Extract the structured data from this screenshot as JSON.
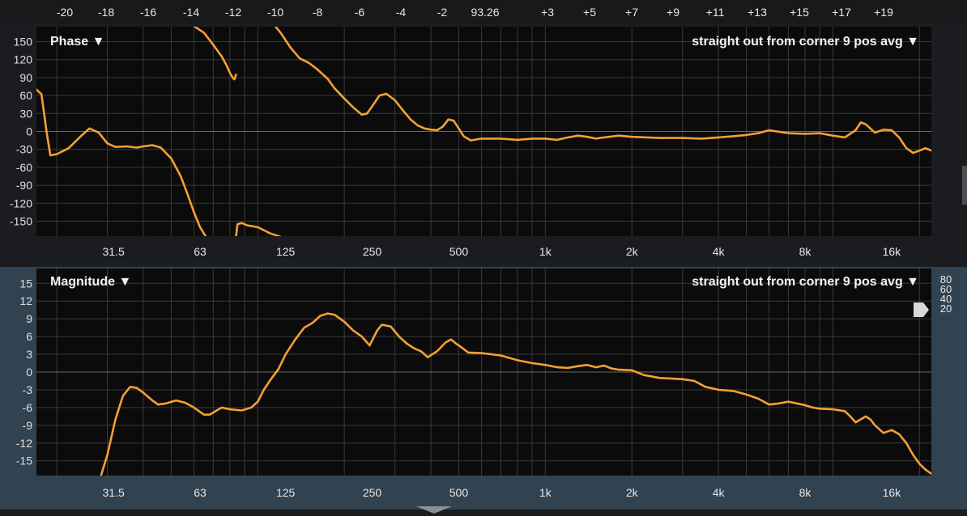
{
  "header": {
    "ticks": [
      "-20",
      "-18",
      "-16",
      "-14",
      "-12",
      "-10",
      "-8",
      "-6",
      "-4",
      "-2",
      "93.26",
      "+3",
      "+5",
      "+7",
      "+9",
      "+11",
      "+13",
      "+15",
      "+17",
      "+19"
    ]
  },
  "colors": {
    "curve": "#f5a033",
    "grid": "#3a3a3a",
    "plot_bg": "#0b0b0b"
  },
  "phase": {
    "title": "Phase ▼",
    "measurement": "straight out from corner 9 pos avg ▼"
  },
  "magnitude": {
    "title": "Magnitude ▼",
    "measurement": "straight out from corner 9 pos avg ▼",
    "right_scale": [
      "80",
      "60",
      "40",
      "20"
    ]
  },
  "chart_data": [
    {
      "type": "line",
      "name": "Phase",
      "x_scale": "log",
      "xlim": [
        17,
        22000
      ],
      "ylim": [
        -175,
        175
      ],
      "x_ticks": [
        31.5,
        63,
        125,
        250,
        500,
        1000,
        2000,
        4000,
        8000,
        16000
      ],
      "x_tick_labels": [
        "31.5",
        "63",
        "125",
        "250",
        "500",
        "1k",
        "2k",
        "4k",
        "8k",
        "16k"
      ],
      "y_ticks": [
        150,
        120,
        90,
        60,
        30,
        0,
        -30,
        -60,
        -90,
        -120,
        -150
      ],
      "segments": [
        [
          [
            17,
            70
          ],
          [
            17.7,
            62
          ],
          [
            18.5,
            -5
          ],
          [
            19,
            -40
          ],
          [
            20,
            -38
          ],
          [
            22,
            -28
          ],
          [
            24,
            -10
          ],
          [
            26,
            5
          ],
          [
            28,
            -2
          ],
          [
            30,
            -20
          ],
          [
            32,
            -26
          ],
          [
            35,
            -25
          ],
          [
            38,
            -27
          ],
          [
            40,
            -25
          ],
          [
            43,
            -23
          ],
          [
            46,
            -27
          ],
          [
            50,
            -45
          ],
          [
            54,
            -75
          ],
          [
            57,
            -105
          ],
          [
            60,
            -135
          ],
          [
            63,
            -160
          ],
          [
            66,
            -176
          ]
        ],
        [
          [
            60,
            176
          ],
          [
            65,
            165
          ],
          [
            70,
            145
          ],
          [
            75,
            125
          ],
          [
            78,
            110
          ],
          [
            80,
            98
          ],
          [
            82,
            89
          ],
          [
            83,
            87
          ],
          [
            84,
            95
          ]
        ],
        [
          [
            84,
            -176
          ],
          [
            85,
            -155
          ],
          [
            88,
            -153
          ],
          [
            92,
            -157
          ],
          [
            100,
            -160
          ],
          [
            110,
            -170
          ],
          [
            120,
            -176
          ]
        ],
        [
          [
            115,
            176
          ],
          [
            120,
            165
          ],
          [
            130,
            140
          ],
          [
            140,
            122
          ],
          [
            150,
            115
          ],
          [
            160,
            105
          ],
          [
            175,
            88
          ],
          [
            185,
            72
          ],
          [
            200,
            55
          ],
          [
            215,
            40
          ],
          [
            230,
            28
          ],
          [
            240,
            30
          ],
          [
            255,
            48
          ],
          [
            265,
            60
          ],
          [
            280,
            63
          ],
          [
            300,
            52
          ],
          [
            320,
            35
          ],
          [
            340,
            20
          ],
          [
            360,
            10
          ],
          [
            380,
            5
          ],
          [
            400,
            3
          ],
          [
            420,
            2
          ],
          [
            440,
            8
          ],
          [
            460,
            20
          ],
          [
            480,
            18
          ],
          [
            500,
            5
          ],
          [
            520,
            -8
          ],
          [
            550,
            -15
          ],
          [
            600,
            -12
          ],
          [
            700,
            -12
          ],
          [
            800,
            -14
          ],
          [
            900,
            -12
          ],
          [
            1000,
            -12
          ],
          [
            1100,
            -14
          ],
          [
            1200,
            -10
          ],
          [
            1300,
            -7
          ],
          [
            1400,
            -9
          ],
          [
            1500,
            -12
          ],
          [
            1600,
            -10
          ],
          [
            1800,
            -7
          ],
          [
            2000,
            -9
          ],
          [
            2500,
            -11
          ],
          [
            3000,
            -11
          ],
          [
            3500,
            -12
          ],
          [
            4000,
            -10
          ],
          [
            4500,
            -8
          ],
          [
            5000,
            -6
          ],
          [
            5500,
            -3
          ],
          [
            6000,
            2
          ],
          [
            7000,
            -3
          ],
          [
            8000,
            -4
          ],
          [
            9000,
            -3
          ],
          [
            10000,
            -7
          ],
          [
            11000,
            -10
          ],
          [
            12000,
            2
          ],
          [
            12500,
            15
          ],
          [
            13000,
            12
          ],
          [
            14000,
            -2
          ],
          [
            15000,
            3
          ],
          [
            16000,
            2
          ],
          [
            17000,
            -10
          ],
          [
            18000,
            -28
          ],
          [
            19000,
            -36
          ],
          [
            20000,
            -32
          ],
          [
            21000,
            -28
          ],
          [
            22000,
            -32
          ]
        ]
      ]
    },
    {
      "type": "line",
      "name": "Magnitude",
      "x_scale": "log",
      "xlim": [
        17,
        22000
      ],
      "ylim": [
        -17.5,
        17.5
      ],
      "x_ticks": [
        31.5,
        63,
        125,
        250,
        500,
        1000,
        2000,
        4000,
        8000,
        16000
      ],
      "x_tick_labels": [
        "31.5",
        "63",
        "125",
        "250",
        "500",
        "1k",
        "2k",
        "4k",
        "8k",
        "16k"
      ],
      "y_ticks": [
        15,
        12,
        9,
        6,
        3,
        0,
        -3,
        -6,
        -9,
        -12,
        -15
      ],
      "segments": [
        [
          [
            28.5,
            -17.5
          ],
          [
            30,
            -14
          ],
          [
            32,
            -8
          ],
          [
            34,
            -4
          ],
          [
            36,
            -2.5
          ],
          [
            38,
            -2.7
          ],
          [
            40,
            -3.5
          ],
          [
            43,
            -4.8
          ],
          [
            45,
            -5.5
          ],
          [
            48,
            -5.3
          ],
          [
            52,
            -4.8
          ],
          [
            56,
            -5.2
          ],
          [
            60,
            -6
          ],
          [
            65,
            -7.2
          ],
          [
            68,
            -7.2
          ],
          [
            72,
            -6.5
          ],
          [
            75,
            -6
          ],
          [
            80,
            -6.3
          ],
          [
            88,
            -6.5
          ],
          [
            95,
            -6
          ],
          [
            100,
            -5
          ],
          [
            105,
            -3
          ],
          [
            110,
            -1.5
          ],
          [
            118,
            0.5
          ],
          [
            125,
            3
          ],
          [
            135,
            5.5
          ],
          [
            145,
            7.5
          ],
          [
            155,
            8.3
          ],
          [
            165,
            9.5
          ],
          [
            175,
            9.9
          ],
          [
            185,
            9.7
          ],
          [
            200,
            8.5
          ],
          [
            215,
            7
          ],
          [
            230,
            6
          ],
          [
            245,
            4.5
          ],
          [
            260,
            7
          ],
          [
            270,
            8
          ],
          [
            290,
            7.7
          ],
          [
            310,
            6
          ],
          [
            330,
            4.8
          ],
          [
            350,
            4
          ],
          [
            370,
            3.5
          ],
          [
            390,
            2.5
          ],
          [
            420,
            3.5
          ],
          [
            450,
            5
          ],
          [
            470,
            5.5
          ],
          [
            490,
            4.8
          ],
          [
            510,
            4.2
          ],
          [
            540,
            3.3
          ],
          [
            600,
            3.2
          ],
          [
            700,
            2.8
          ],
          [
            800,
            2
          ],
          [
            900,
            1.5
          ],
          [
            1000,
            1.2
          ],
          [
            1100,
            0.8
          ],
          [
            1200,
            0.7
          ],
          [
            1300,
            1
          ],
          [
            1400,
            1.2
          ],
          [
            1500,
            0.8
          ],
          [
            1600,
            1.1
          ],
          [
            1700,
            0.6
          ],
          [
            1800,
            0.4
          ],
          [
            2000,
            0.3
          ],
          [
            2200,
            -0.5
          ],
          [
            2500,
            -1
          ],
          [
            3000,
            -1.2
          ],
          [
            3300,
            -1.5
          ],
          [
            3600,
            -2.5
          ],
          [
            4000,
            -3
          ],
          [
            4500,
            -3.2
          ],
          [
            5000,
            -3.8
          ],
          [
            5500,
            -4.5
          ],
          [
            6000,
            -5.5
          ],
          [
            6500,
            -5.3
          ],
          [
            7000,
            -5
          ],
          [
            7500,
            -5.3
          ],
          [
            8000,
            -5.6
          ],
          [
            8500,
            -6
          ],
          [
            9000,
            -6.2
          ],
          [
            10000,
            -6.3
          ],
          [
            11000,
            -6.6
          ],
          [
            11500,
            -7.5
          ],
          [
            12000,
            -8.5
          ],
          [
            13000,
            -7.5
          ],
          [
            13500,
            -8
          ],
          [
            14000,
            -9
          ],
          [
            15000,
            -10.3
          ],
          [
            16000,
            -9.8
          ],
          [
            17000,
            -10.5
          ],
          [
            18000,
            -12
          ],
          [
            19000,
            -14
          ],
          [
            20000,
            -15.5
          ],
          [
            21000,
            -16.5
          ],
          [
            22000,
            -17.2
          ]
        ]
      ]
    }
  ]
}
